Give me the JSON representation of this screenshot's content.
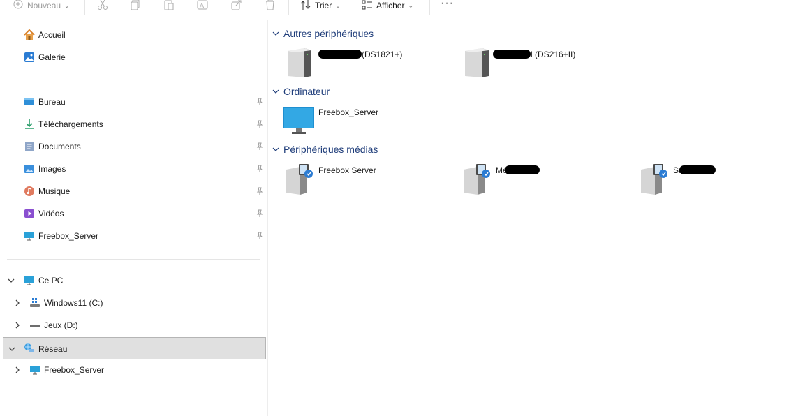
{
  "toolbar": {
    "new_label": "Nouveau",
    "sort_label": "Trier",
    "view_label": "Afficher",
    "more_label": "···"
  },
  "sidebar": {
    "quick": [
      {
        "label": "Accueil",
        "icon": "home-icon"
      },
      {
        "label": "Galerie",
        "icon": "gallery-icon"
      }
    ],
    "pinned": [
      {
        "label": "Bureau",
        "icon": "desktop-folder-icon"
      },
      {
        "label": "Téléchargements",
        "icon": "downloads-icon"
      },
      {
        "label": "Documents",
        "icon": "documents-icon"
      },
      {
        "label": "Images",
        "icon": "pictures-icon"
      },
      {
        "label": "Musique",
        "icon": "music-icon"
      },
      {
        "label": "Vidéos",
        "icon": "videos-icon"
      },
      {
        "label": "Freebox_Server",
        "icon": "monitor-icon"
      }
    ],
    "tree": [
      {
        "label": "Ce PC",
        "icon": "monitor-icon",
        "expanded": true
      },
      {
        "label": "Windows11 (C:)",
        "icon": "windows-drive-icon"
      },
      {
        "label": "Jeux (D:)",
        "icon": "drive-icon"
      },
      {
        "label": "Réseau",
        "icon": "network-icon",
        "expanded": true,
        "selected": true
      },
      {
        "label": "Freebox_Server",
        "icon": "monitor-icon"
      }
    ]
  },
  "content": {
    "groups": [
      {
        "title": "Autres périphériques"
      },
      {
        "title": "Ordinateur"
      },
      {
        "title": "Périphériques médias"
      }
    ],
    "other_devices": [
      {
        "suffix": "(DS1821+)",
        "icon": "nas-icon"
      },
      {
        "suffix": "l (DS216+II)",
        "icon": "nas-icon"
      }
    ],
    "computers": [
      {
        "label": "Freebox_Server",
        "icon": "monitor-icon"
      }
    ],
    "media": [
      {
        "label": "Freebox Server",
        "icon": "media-server-icon"
      },
      {
        "prefix": "Me",
        "icon": "media-server-icon"
      },
      {
        "prefix": "Sa",
        "icon": "media-server-icon"
      }
    ]
  },
  "colors": {
    "accent": "#1f3d7a",
    "selected_bg": "#e0e0e0",
    "folder_blue": "#2b7cd3"
  }
}
